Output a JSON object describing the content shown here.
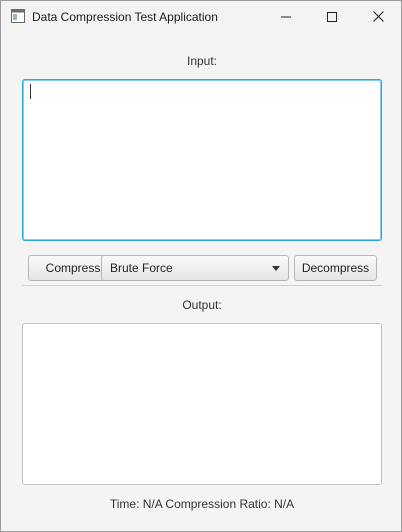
{
  "window": {
    "title": "Data Compression Test Application",
    "icon": "app-window-icon"
  },
  "input": {
    "label": "Input:",
    "value": ""
  },
  "toolbar": {
    "compress_label": "Compress",
    "algorithm_selected": "Brute Force",
    "decompress_label": "Decompress"
  },
  "output": {
    "label": "Output:",
    "value": ""
  },
  "status": {
    "text": "Time: N/A Compression Ratio: N/A"
  },
  "colors": {
    "focus_border": "#2aa7e0",
    "background": "#f4f4f4"
  }
}
